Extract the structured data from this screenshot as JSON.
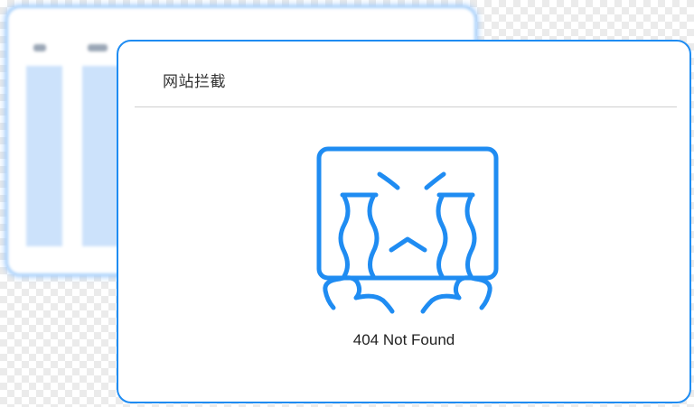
{
  "dialog": {
    "title": "网站拦截",
    "message": "404 Not Found"
  },
  "illustration": {
    "icon": "crying-face-icon",
    "stroke_color": "#1f8cf2"
  },
  "background_window": {
    "accent_color": "#a9d1fb",
    "column_color": "#cce2fb"
  }
}
